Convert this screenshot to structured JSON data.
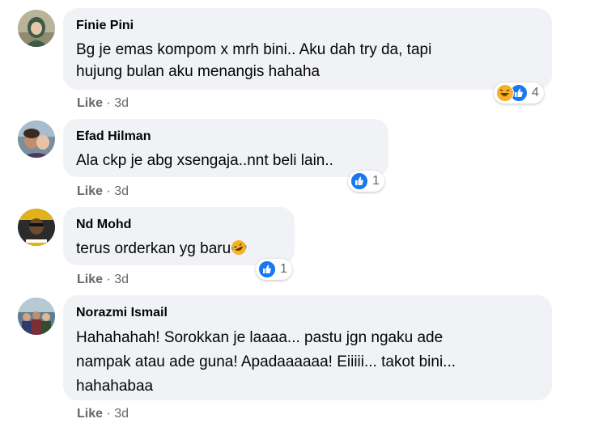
{
  "comments": [
    {
      "author": "Finie Pini",
      "text": "Bg je emas kompom x mrh bini.. Aku dah try da, tapi\nhujung bulan aku menangis hahaha",
      "reaction_count": "4",
      "like": "Like",
      "dot": "·",
      "time": "3d"
    },
    {
      "author": "Efad Hilman",
      "text": "Ala ckp je abg xsengaja..nnt beli lain..",
      "reaction_count": "1",
      "like": "Like",
      "dot": "·",
      "time": "3d"
    },
    {
      "author": "Nd Mohd",
      "text": "terus orderkan yg baru",
      "reaction_count": "1",
      "like": "Like",
      "dot": "·",
      "time": "3d"
    },
    {
      "author": "Norazmi Ismail",
      "text": "Hahahahah! Sorokkan je laaaa... pastu jgn ngaku ade\nnampak atau ade guna! Apadaaaaaa! Eiiiii... takot bini...\nhahahabaa",
      "like": "Like",
      "dot": "·",
      "time": "3d"
    }
  ],
  "colors": {
    "bubble": "#f0f2f5",
    "like_blue": "#1877f2",
    "haha_yellow": "#f7b125",
    "meta_gray": "#65676b"
  }
}
